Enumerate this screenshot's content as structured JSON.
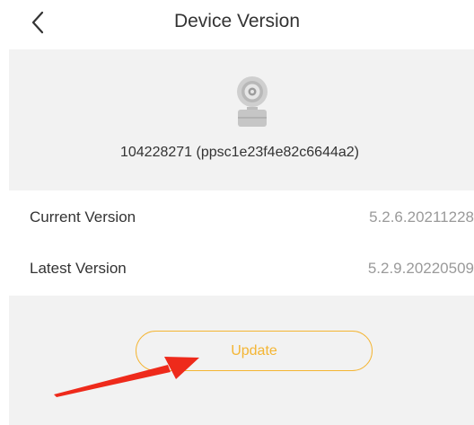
{
  "header": {
    "title": "Device Version",
    "back_icon": "chevron-left-icon"
  },
  "device": {
    "icon": "camera-icon",
    "id_text": "104228271 (ppsc1e23f4e82c6644a2)"
  },
  "versions": {
    "current_label": "Current Version",
    "current_value": "5.2.6.20211228",
    "latest_label": "Latest Version",
    "latest_value": "5.2.9.20220509"
  },
  "actions": {
    "update_label": "Update"
  },
  "colors": {
    "accent": "#f4b533",
    "annotation_arrow": "#ee2a1b",
    "card_background": "#f2f2f2",
    "muted_text": "#9a9a9a",
    "primary_text": "#333333"
  }
}
